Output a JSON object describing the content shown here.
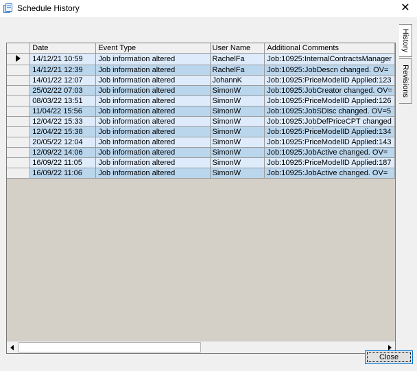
{
  "window": {
    "title": "Schedule History",
    "close_glyph": "✕",
    "icon": "document-stack-icon"
  },
  "grid": {
    "columns": [
      "Date",
      "Event Type",
      "User Name",
      "Additional Comments"
    ],
    "current_row": 0,
    "rows": [
      {
        "date": "14/12/21 10:59",
        "event": "Job information altered",
        "user": "RachelFa",
        "comment": "Job:10925:InternalContractsManager"
      },
      {
        "date": "14/12/21 12:39",
        "event": "Job information altered",
        "user": "RachelFa",
        "comment": "Job:10925:JobDescn changed. OV="
      },
      {
        "date": "14/01/22 12:07",
        "event": "Job information altered",
        "user": "JohannK",
        "comment": "Job:10925:PriceModelID Applied:123"
      },
      {
        "date": "25/02/22 07:03",
        "event": "Job information altered",
        "user": "SimonW",
        "comment": "Job:10925:JobCreator changed. OV="
      },
      {
        "date": "08/03/22 13:51",
        "event": "Job information altered",
        "user": "SimonW",
        "comment": "Job:10925:PriceModelID Applied:126"
      },
      {
        "date": "11/04/22 15:56",
        "event": "Job information altered",
        "user": "SimonW",
        "comment": "Job:10925:JobSDisc changed. OV=5"
      },
      {
        "date": "12/04/22 15:33",
        "event": "Job information altered",
        "user": "SimonW",
        "comment": "Job:10925:JobDefPriceCPT changed"
      },
      {
        "date": "12/04/22 15:38",
        "event": "Job information altered",
        "user": "SimonW",
        "comment": "Job:10925:PriceModelID Applied:134"
      },
      {
        "date": "20/05/22 12:04",
        "event": "Job information altered",
        "user": "SimonW",
        "comment": "Job:10925:PriceModelID Applied:143"
      },
      {
        "date": "12/09/22 14:06",
        "event": "Job information altered",
        "user": "SimonW",
        "comment": "Job:10925:JobActive changed. OV="
      },
      {
        "date": "16/09/22 11:05",
        "event": "Job information altered",
        "user": "SimonW",
        "comment": "Job:10925:PriceModelID Applied:187"
      },
      {
        "date": "16/09/22 11:06",
        "event": "Job information altered",
        "user": "SimonW",
        "comment": "Job:10925:JobActive changed. OV="
      }
    ]
  },
  "tabs": [
    {
      "label": "History",
      "active": true
    },
    {
      "label": "Revisions",
      "active": false
    }
  ],
  "buttons": {
    "close_label": "Close"
  },
  "colors": {
    "row_odd": "#ddebfb",
    "row_even": "#bad6ed",
    "grid_bg": "#d4d0c8",
    "button_border": "#0078d7"
  },
  "scrollbar": {
    "horizontal_position": 0.0,
    "visible_fraction": 0.5
  }
}
